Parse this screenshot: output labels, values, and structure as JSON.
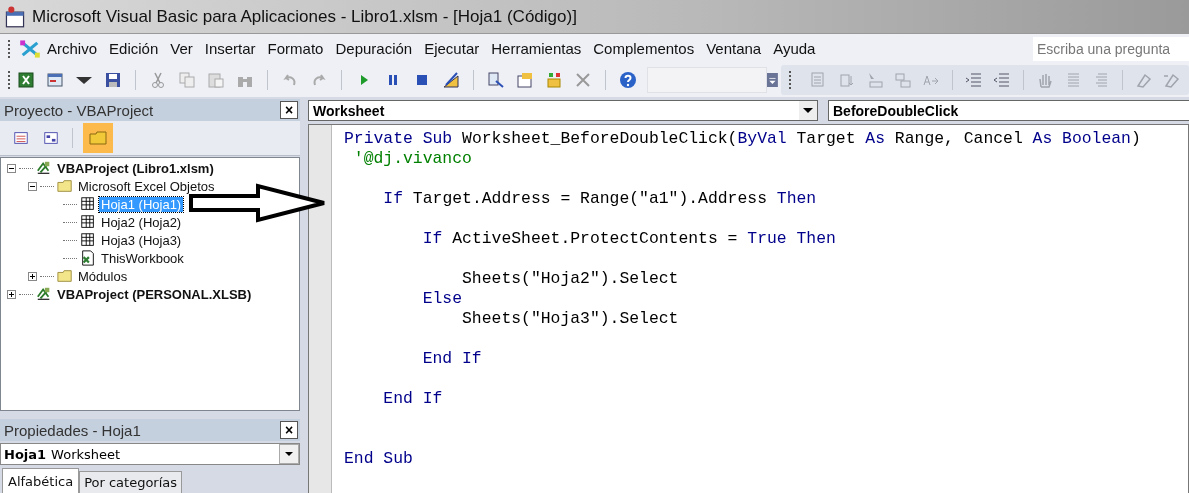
{
  "window": {
    "title": "Microsoft Visual Basic para Aplicaciones - Libro1.xlsm - [Hoja1 (Código)]"
  },
  "menu": [
    {
      "label": "Archivo"
    },
    {
      "label": "Edición"
    },
    {
      "label": "Ver"
    },
    {
      "label": "Insertar"
    },
    {
      "label": "Formato"
    },
    {
      "label": "Depuración"
    },
    {
      "label": "Ejecutar"
    },
    {
      "label": "Herramientas"
    },
    {
      "label": "Complementos"
    },
    {
      "label": "Ventana"
    },
    {
      "label": "Ayuda"
    }
  ],
  "help_search": {
    "placeholder": "Escriba una pregunta"
  },
  "project_pane": {
    "title": "Proyecto - VBAProject",
    "close": "×",
    "tree": [
      {
        "label": "VBAProject (Libro1.xlsm)",
        "kind": "project",
        "expanded": true,
        "selected": false,
        "children": [
          {
            "label": "Microsoft Excel Objetos",
            "kind": "folder",
            "expanded": true,
            "selected": false,
            "children": [
              {
                "label": "Hoja1 (Hoja1)",
                "kind": "sheet",
                "selected": true
              },
              {
                "label": "Hoja2 (Hoja2)",
                "kind": "sheet",
                "selected": false
              },
              {
                "label": "Hoja3 (Hoja3)",
                "kind": "sheet",
                "selected": false
              },
              {
                "label": "ThisWorkbook",
                "kind": "workbook",
                "selected": false
              }
            ]
          },
          {
            "label": "Módulos",
            "kind": "folder",
            "expanded": false,
            "selected": false
          }
        ]
      },
      {
        "label": "VBAProject (PERSONAL.XLSB)",
        "kind": "project",
        "expanded": false,
        "selected": false
      }
    ]
  },
  "properties_pane": {
    "title": "Propiedades - Hoja1",
    "close": "×",
    "object_name": "Hoja1",
    "object_type": "Worksheet",
    "tabs": [
      {
        "label": "Alfabética",
        "selected": true
      },
      {
        "label": "Por categorías",
        "selected": false
      }
    ]
  },
  "code_window": {
    "object": "Worksheet",
    "procedure": "BeforeDoubleClick",
    "lines": [
      {
        "kind": "code",
        "tokens": [
          {
            "t": "Private Sub",
            "kind": "keyword"
          },
          {
            "t": " Worksheet_BeforeDoubleClick(",
            "kind": "plain"
          },
          {
            "t": "ByVal",
            "kind": "keyword"
          },
          {
            "t": " Target ",
            "kind": "plain"
          },
          {
            "t": "As",
            "kind": "keyword"
          },
          {
            "t": " Range, Cancel ",
            "kind": "plain"
          },
          {
            "t": "As Boolean",
            "kind": "keyword"
          },
          {
            "t": ")",
            "kind": "plain"
          }
        ]
      },
      {
        "kind": "code",
        "tokens": [
          {
            "t": " '@dj.vivanco",
            "kind": "comment"
          }
        ]
      },
      {
        "kind": "blank"
      },
      {
        "kind": "code",
        "tokens": [
          {
            "t": "    If",
            "kind": "keyword"
          },
          {
            "t": " Target.Address = Range(\"a1\").Address ",
            "kind": "plain"
          },
          {
            "t": "Then",
            "kind": "keyword"
          }
        ]
      },
      {
        "kind": "blank"
      },
      {
        "kind": "code",
        "tokens": [
          {
            "t": "        If",
            "kind": "keyword"
          },
          {
            "t": " ActiveSheet.ProtectContents = ",
            "kind": "plain"
          },
          {
            "t": "True Then",
            "kind": "keyword"
          }
        ]
      },
      {
        "kind": "blank"
      },
      {
        "kind": "code",
        "tokens": [
          {
            "t": "            Sheets(\"Hoja2\").Select",
            "kind": "plain"
          }
        ]
      },
      {
        "kind": "code",
        "tokens": [
          {
            "t": "        Else",
            "kind": "keyword"
          }
        ]
      },
      {
        "kind": "code",
        "tokens": [
          {
            "t": "            Sheets(\"Hoja3\").Select",
            "kind": "plain"
          }
        ]
      },
      {
        "kind": "blank"
      },
      {
        "kind": "code",
        "tokens": [
          {
            "t": "        End If",
            "kind": "keyword"
          }
        ]
      },
      {
        "kind": "blank"
      },
      {
        "kind": "code",
        "tokens": [
          {
            "t": "    End If",
            "kind": "keyword"
          }
        ]
      },
      {
        "kind": "blank"
      },
      {
        "kind": "blank"
      },
      {
        "kind": "code",
        "tokens": [
          {
            "t": "End Sub",
            "kind": "keyword"
          }
        ]
      }
    ]
  }
}
